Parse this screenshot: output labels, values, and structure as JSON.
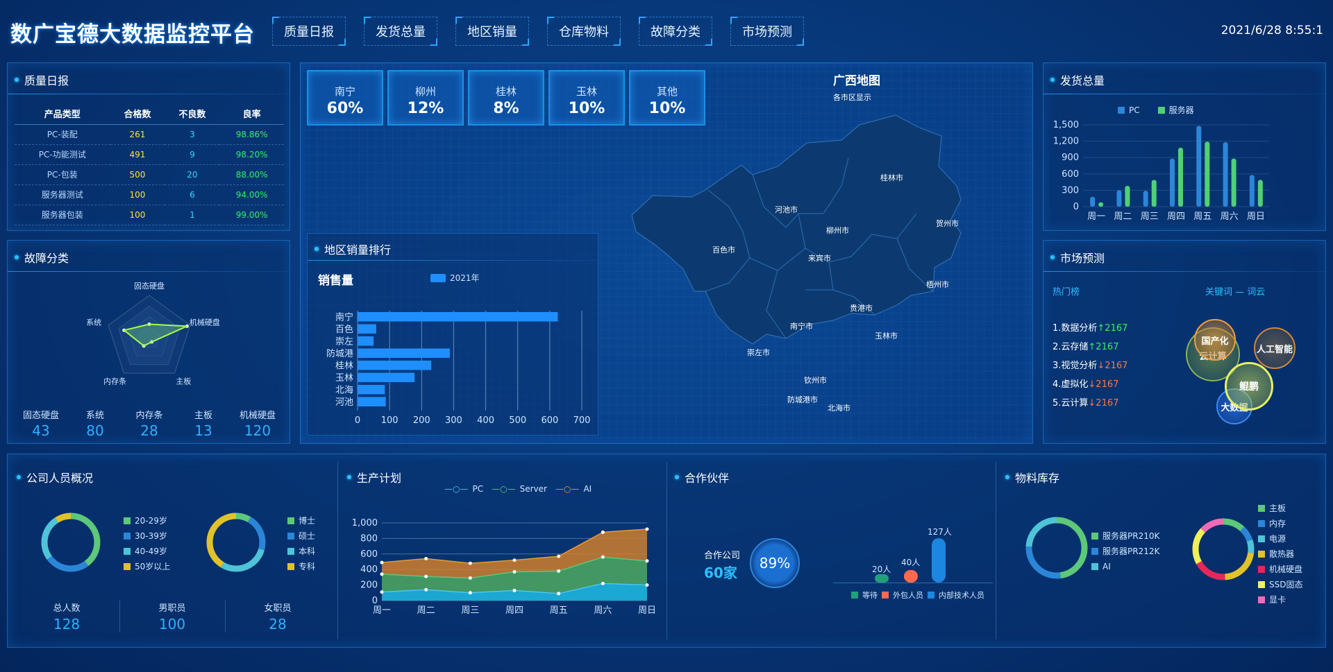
{
  "header": {
    "title": "数广宝德大数据监控平台",
    "nav": [
      "质量日报",
      "发货总量",
      "地区销量",
      "仓库物料",
      "故障分类",
      "市场预测"
    ],
    "datetime": "2021/6/28 8:55:1"
  },
  "quality": {
    "title": "质量日报",
    "columns": [
      "产品类型",
      "合格数",
      "不良数",
      "良率"
    ],
    "rows": [
      [
        "PC-装配",
        "261",
        "3",
        "98.86%"
      ],
      [
        "PC-功能测试",
        "491",
        "9",
        "98.20%"
      ],
      [
        "PC-包装",
        "500",
        "20",
        "88.00%"
      ],
      [
        "服务器测试",
        "100",
        "6",
        "94.00%"
      ],
      [
        "服务器包装",
        "100",
        "1",
        "99.00%"
      ]
    ]
  },
  "fault": {
    "title": "故障分类",
    "radar_labels": [
      "固态硬盘",
      "机械硬盘",
      "主板",
      "内存条",
      "系统"
    ],
    "radar_values": [
      43,
      120,
      13,
      28,
      80
    ],
    "stats": [
      {
        "label": "固态硬盘",
        "value": "43"
      },
      {
        "label": "系统",
        "value": "80"
      },
      {
        "label": "内存条",
        "value": "28"
      },
      {
        "label": "主板",
        "value": "13"
      },
      {
        "label": "机械硬盘",
        "value": "120"
      }
    ]
  },
  "regions": [
    {
      "name": "南宁",
      "value": "60%"
    },
    {
      "name": "柳州",
      "value": "12%"
    },
    {
      "name": "桂林",
      "value": "8%"
    },
    {
      "name": "玉林",
      "value": "10%"
    },
    {
      "name": "其他",
      "value": "10%"
    }
  ],
  "map": {
    "title": "广西地图",
    "subtitle": "各市区显示",
    "cities": [
      "桂林市",
      "河池市",
      "贺州市",
      "柳州市",
      "百色市",
      "来宾市",
      "梧州市",
      "贵港市",
      "南宁市",
      "玉林市",
      "崇左市",
      "钦州市",
      "防城港市",
      "北海市"
    ]
  },
  "sales": {
    "title": "地区销量排行",
    "chart_title": "销售量",
    "legend": "2021年"
  },
  "shipment": {
    "title": "发货总量"
  },
  "forecast": {
    "title": "市场预测",
    "hot_label": "热门榜",
    "kw_label": "关键词 — 词云",
    "items": [
      {
        "text": "1.数据分析",
        "trend": "↑2167",
        "up": true
      },
      {
        "text": "2.云存储",
        "trend": "↑2167",
        "up": true
      },
      {
        "text": "3.视觉分析",
        "trend": "↓2167",
        "up": false
      },
      {
        "text": "4.虚拟化",
        "trend": "↓2167",
        "up": false
      },
      {
        "text": "5.云计算",
        "trend": "↓2167",
        "up": false
      }
    ],
    "bubbles": [
      "国产化",
      "云计算",
      "人工智能",
      "鲲鹏",
      "大数据"
    ]
  },
  "staff": {
    "title": "公司人员概况",
    "age_legend": [
      "20-29岁",
      "30-39岁",
      "40-49岁",
      "50岁以上"
    ],
    "edu_legend": [
      "博士",
      "硕士",
      "本科",
      "专科"
    ],
    "stats": [
      {
        "label": "总人数",
        "value": "128"
      },
      {
        "label": "男职员",
        "value": "100"
      },
      {
        "label": "女职员",
        "value": "28"
      }
    ]
  },
  "production": {
    "title": "生产计划"
  },
  "partner": {
    "title": "合作伙伴",
    "company_label": "合作公司",
    "company_value": "60家",
    "percent": "89%",
    "bar_labels": [
      "20人",
      "40人",
      "127人"
    ],
    "legend": [
      "等待",
      "外包人员",
      "内部技术人员"
    ]
  },
  "material": {
    "title": "物料库存",
    "legend1": [
      "服务器PR210K",
      "服务器PR212K",
      "AI"
    ],
    "legend2": [
      "主板",
      "内存",
      "电源",
      "散热器",
      "机械硬盘",
      "SSD固态",
      "显卡"
    ]
  },
  "colors": {
    "accent": "#2cc0ff",
    "green": "#37f06b",
    "yellow": "#ffe14a",
    "red": "#ff7a45",
    "bar": "#1f8fff"
  },
  "chart_data": [
    {
      "type": "bar",
      "title": "销售量",
      "orientation": "horizontal",
      "categories": [
        "南宁",
        "百色",
        "崇左",
        "防城港",
        "桂林",
        "玉林",
        "北海",
        "河池"
      ],
      "series": [
        {
          "name": "2021年",
          "values": [
            625,
            58,
            50,
            288,
            230,
            178,
            85,
            88
          ]
        }
      ],
      "xlim": [
        0,
        700
      ],
      "xticks": [
        0,
        100,
        200,
        300,
        400,
        500,
        600,
        700
      ]
    },
    {
      "type": "bar",
      "categories": [
        "周一",
        "周二",
        "周三",
        "周四",
        "周五",
        "周六",
        "周日"
      ],
      "series": [
        {
          "name": "PC",
          "values": [
            180,
            300,
            290,
            880,
            1480,
            1180,
            580
          ]
        },
        {
          "name": "服务器",
          "values": [
            80,
            380,
            490,
            1080,
            1190,
            880,
            490
          ]
        }
      ],
      "ylim": [
        0,
        1500
      ],
      "yticks": [
        0,
        300,
        600,
        900,
        1200,
        1500
      ]
    },
    {
      "type": "area",
      "categories": [
        "周一",
        "周二",
        "周三",
        "周四",
        "周五",
        "周六",
        "周日"
      ],
      "series": [
        {
          "name": "PC",
          "values": [
            110,
            140,
            100,
            130,
            90,
            220,
            200
          ]
        },
        {
          "name": "Server",
          "values": [
            340,
            310,
            290,
            370,
            380,
            560,
            510
          ]
        },
        {
          "name": "AI",
          "values": [
            490,
            540,
            480,
            520,
            570,
            880,
            920
          ]
        }
      ],
      "ylim": [
        0,
        1000
      ],
      "yticks": [
        0,
        200,
        400,
        600,
        800,
        1000
      ]
    }
  ]
}
